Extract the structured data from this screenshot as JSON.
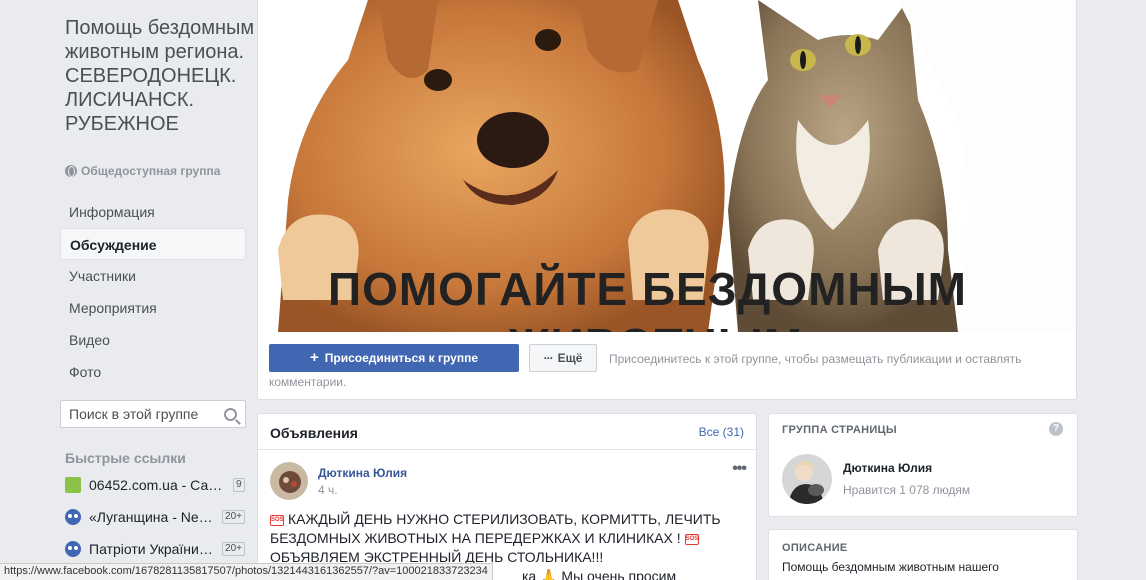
{
  "group": {
    "title": "Помощь бездомным животным региона. СЕВЕРОДОНЕЦК. ЛИСИЧАНСК. РУБЕЖНОЕ",
    "type": "Общедоступная группа"
  },
  "nav": [
    {
      "label": "Информация",
      "active": false
    },
    {
      "label": "Обсуждение",
      "active": true
    },
    {
      "label": "Участники",
      "active": false
    },
    {
      "label": "Мероприятия",
      "active": false
    },
    {
      "label": "Видео",
      "active": false
    },
    {
      "label": "Фото",
      "active": false
    }
  ],
  "search": {
    "placeholder": "Поиск в этой группе"
  },
  "quick_links": {
    "title": "Быстрые ссылки",
    "items": [
      {
        "label": "06452.com.ua - Сайт...",
        "badge": "9",
        "icon": "site-icon"
      },
      {
        "label": "«Луганщина - News»",
        "badge": "20+",
        "icon": "group-icon"
      },
      {
        "label": "Патріоти України - ...",
        "badge": "20+",
        "icon": "group-icon"
      }
    ]
  },
  "cover": {
    "caption_line1": "ПОМОГАЙТЕ БЕЗДОМНЫМ",
    "caption_line2": "ЖИВОТНЫМ"
  },
  "actions": {
    "join_label": "Присоединиться к группе",
    "more_label": "Ещё",
    "hint": "Присоединитесь к этой группе, чтобы размещать публикации и оставлять комментарии."
  },
  "announcements": {
    "title": "Объявления",
    "all_label": "Все (31)",
    "post": {
      "author": "Дюткина Юлия",
      "time": "4 ч.",
      "line1": "КАЖДЫЙ ДЕНЬ НУЖНО СТЕРИЛИЗОВАТЬ, КОРМИТТЬ, ЛЕЧИТЬ",
      "line2": "БЕЗДОМНЫХ ЖИВОТНЫХ НА ПЕРЕДЕРЖКАХ И КЛИНИКАХ !",
      "line3": "ОБЪЯВЛЯЕМ ЭКСТРЕННЫЙ ДЕНЬ СТОЛЬНИКА!!!",
      "line4": "ка 🙏 Мы очень просим"
    }
  },
  "page_group": {
    "title": "ГРУППА СТРАНИЦЫ",
    "help": "?",
    "name": "Дюткина Юлия",
    "likes": "Нравится 1 078 людям"
  },
  "description": {
    "title": "ОПИСАНИЕ",
    "text": "Помощь бездомным животным нашего"
  },
  "status_bar": {
    "url": "https://www.facebook.com/1678281135817507/photos/1321443161362557/?av=100021833723234"
  },
  "colors": {
    "accent": "#4267b2",
    "link": "#385898",
    "background": "#e9ebee"
  }
}
